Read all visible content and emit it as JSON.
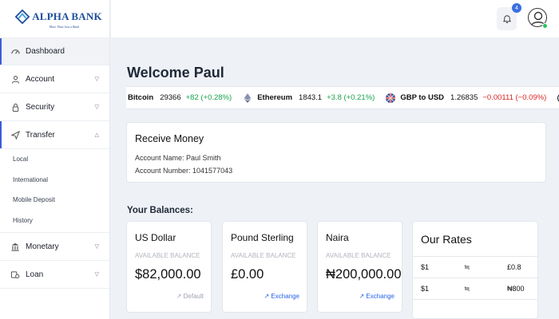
{
  "brand": {
    "name": "ALPHA BANK",
    "tagline": "More Than Just a Bank"
  },
  "sidebar": {
    "items": [
      {
        "label": "Dashboard",
        "icon": "dashboard-icon"
      },
      {
        "label": "Account",
        "icon": "user-icon"
      },
      {
        "label": "Security",
        "icon": "lock-icon"
      },
      {
        "label": "Transfer",
        "icon": "send-icon"
      },
      {
        "label": "Monetary",
        "icon": "bank-icon"
      },
      {
        "label": "Loan",
        "icon": "loan-icon"
      }
    ],
    "transfer_sub": [
      "Local",
      "International",
      "Mobile Deposit",
      "History"
    ]
  },
  "topbar": {
    "notification_count": "4"
  },
  "welcome": {
    "prefix": "Welcome",
    "name": "Paul"
  },
  "ticker": [
    {
      "name": "Bitcoin",
      "price": "29366",
      "change": "+82 (+0.28%)",
      "direction": "up",
      "icon": "bitcoin-icon"
    },
    {
      "name": "Ethereum",
      "price": "1843.1",
      "change": "+3.8 (+0.21%)",
      "direction": "up",
      "icon": "ethereum-icon"
    },
    {
      "name": "GBP to USD",
      "price": "1.26835",
      "change": "−0.00111 (−0.09%)",
      "direction": "down",
      "icon": "uk-flag-icon"
    }
  ],
  "receive": {
    "title": "Receive Money",
    "account_name_label": "Account Name: Paul Smith",
    "account_number_label": "Account Number: 1041577043"
  },
  "balances_title": "Your Balances:",
  "balances": [
    {
      "currency": "US Dollar",
      "label": "AVAILABLE BALANCE",
      "amount": "$82,000.00",
      "action": "↗ Default"
    },
    {
      "currency": "Pound Sterling",
      "label": "AVAILABLE BALANCE",
      "amount": "£0.00",
      "action": "↗ Exchange"
    },
    {
      "currency": "Naira",
      "label": "AVAILABLE BALANCE",
      "amount": "₦200,000.00",
      "action": "↗ Exchange"
    }
  ],
  "rates": {
    "title": "Our Rates",
    "rows": [
      {
        "from": "$1",
        "eq": "≒",
        "to": "£0.8"
      },
      {
        "from": "$1",
        "eq": "≒",
        "to": "₦800"
      }
    ]
  },
  "colors": {
    "accent": "#3b5bdb",
    "brand": "#1f4e9c",
    "up": "#16a34a",
    "down": "#dc2626",
    "online": "#22c55e"
  }
}
